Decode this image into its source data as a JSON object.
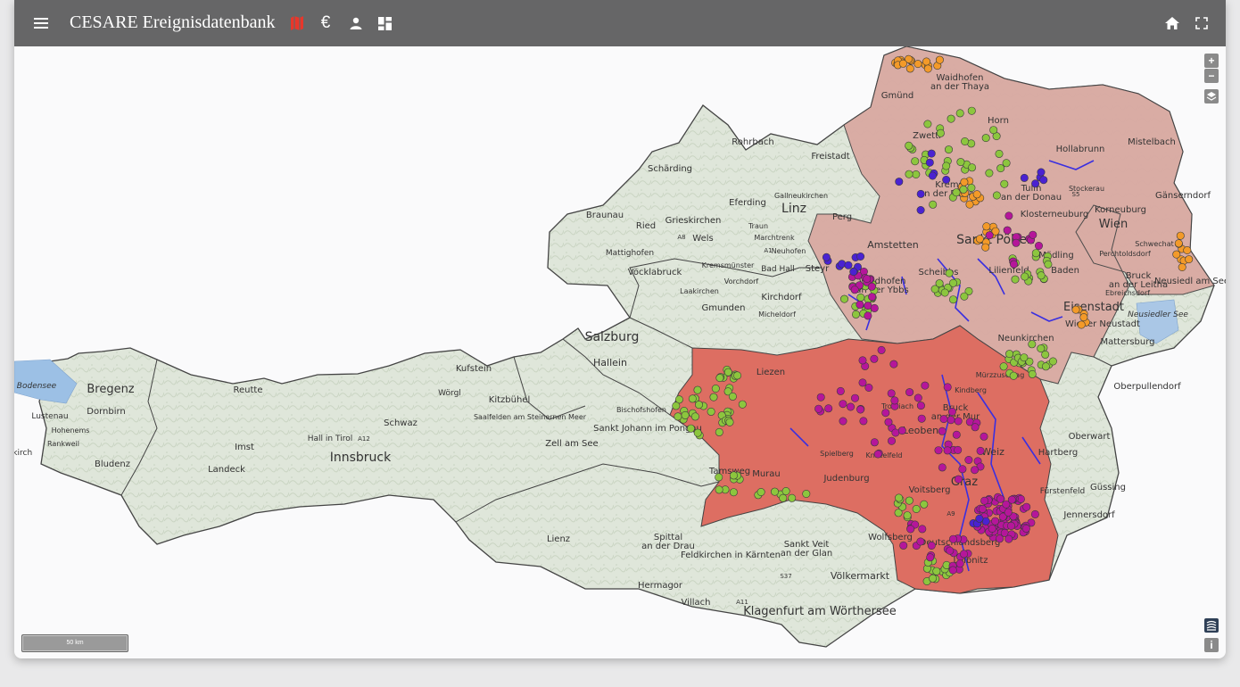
{
  "toolbar": {
    "title": "CESARE Ereignisdatenbank",
    "icons": [
      "menu-icon",
      "map-icon",
      "euro-icon",
      "person-icon",
      "dashboard-icon",
      "home-icon",
      "fullscreen-icon"
    ],
    "accent_color": "#e8372b"
  },
  "map_controls": {
    "zoom_in": "+",
    "zoom_out": "−",
    "info": "i"
  },
  "scale_bar": {
    "label": "50 km"
  },
  "legend_colors": {
    "region_light": "#d9a9a2",
    "region_dark": "#dd6e62",
    "point_green": "#8cc63e",
    "point_magenta": "#b5169a",
    "point_blue": "#4a22d1",
    "point_orange": "#f39a29"
  },
  "place_labels": [
    {
      "id": "gmuend",
      "text": "Gmünd"
    },
    {
      "id": "waidhofen-thaya",
      "text": "Waidhofen an der Thaya"
    },
    {
      "id": "horn",
      "text": "Horn"
    },
    {
      "id": "zwettl",
      "text": "Zwettl"
    },
    {
      "id": "hollabrunn",
      "text": "Hollabrunn"
    },
    {
      "id": "mistelbach",
      "text": "Mistelbach"
    },
    {
      "id": "rohrbach",
      "text": "Rohrbach"
    },
    {
      "id": "freistadt",
      "text": "Freistadt"
    },
    {
      "id": "schaerding",
      "text": "Schärding"
    },
    {
      "id": "eferding",
      "text": "Eferding"
    },
    {
      "id": "gallneukirchen",
      "text": "Gallneukirchen"
    },
    {
      "id": "linz",
      "text": "Linz"
    },
    {
      "id": "perg",
      "text": "Perg"
    },
    {
      "id": "krems",
      "text": "Krems an der Donau"
    },
    {
      "id": "tulln",
      "text": "Tulln an der Donau"
    },
    {
      "id": "stockerau",
      "text": "Stockerau"
    },
    {
      "id": "korneuburg",
      "text": "Korneuburg"
    },
    {
      "id": "klosterneuburg",
      "text": "Klosterneuburg"
    },
    {
      "id": "gaenserndorf",
      "text": "Gänserndorf"
    },
    {
      "id": "wien",
      "text": "Wien"
    },
    {
      "id": "braunau",
      "text": "Braunau"
    },
    {
      "id": "ried",
      "text": "Ried"
    },
    {
      "id": "grieskirchen",
      "text": "Grieskirchen"
    },
    {
      "id": "wels",
      "text": "Wels"
    },
    {
      "id": "traun",
      "text": "Traun"
    },
    {
      "id": "marchtrenk",
      "text": "Marchtrenk"
    },
    {
      "id": "neuhofen",
      "text": "Neuhofen"
    },
    {
      "id": "amstetten",
      "text": "Amstetten"
    },
    {
      "id": "st-poelten",
      "text": "Sankt Pölten"
    },
    {
      "id": "schwechat",
      "text": "Schwechat"
    },
    {
      "id": "perchtoldsdorf",
      "text": "Perchtoldsdorf"
    },
    {
      "id": "moedling",
      "text": "Mödling"
    },
    {
      "id": "baden",
      "text": "Baden"
    },
    {
      "id": "bruck-leitha",
      "text": "Bruck an der Leitha"
    },
    {
      "id": "neusiedl",
      "text": "Neusiedl am See"
    },
    {
      "id": "mattighofen",
      "text": "Mattighofen"
    },
    {
      "id": "voecklabruck",
      "text": "Vöcklabruck"
    },
    {
      "id": "kremsmuenster",
      "text": "Kremsmünster"
    },
    {
      "id": "bad-hall",
      "text": "Bad Hall"
    },
    {
      "id": "steyr",
      "text": "Steyr"
    },
    {
      "id": "waidhofen-ybbs",
      "text": "Waidhofen an der Ybbs"
    },
    {
      "id": "scheibbs",
      "text": "Scheibbs"
    },
    {
      "id": "lilienfeld",
      "text": "Lilienfeld"
    },
    {
      "id": "ebreichsdorf",
      "text": "Ebreichsdorf"
    },
    {
      "id": "laakirchen",
      "text": "Laakirchen"
    },
    {
      "id": "vorchdorf",
      "text": "Vorchdorf"
    },
    {
      "id": "kirchdorf",
      "text": "Kirchdorf"
    },
    {
      "id": "gmunden",
      "text": "Gmunden"
    },
    {
      "id": "micheldorf",
      "text": "Micheldorf"
    },
    {
      "id": "eisenstadt",
      "text": "Eisenstadt"
    },
    {
      "id": "neusiedler-see",
      "text": "Neusiedler See"
    },
    {
      "id": "wiener-neustadt",
      "text": "Wiener Neustadt"
    },
    {
      "id": "neunkirchen",
      "text": "Neunkirchen"
    },
    {
      "id": "mattersburg",
      "text": "Mattersburg"
    },
    {
      "id": "salzburg",
      "text": "Salzburg"
    },
    {
      "id": "hallein",
      "text": "Hallein"
    },
    {
      "id": "liezen",
      "text": "Liezen"
    },
    {
      "id": "muerzzuschlag",
      "text": "Mürzzuschlag"
    },
    {
      "id": "kapfenberg",
      "text": "Kindberg"
    },
    {
      "id": "oberpullendorf",
      "text": "Oberpullendorf"
    },
    {
      "id": "bodensee",
      "text": "Bodensee"
    },
    {
      "id": "bregenz",
      "text": "Bregenz"
    },
    {
      "id": "reutte",
      "text": "Reutte"
    },
    {
      "id": "kufstein",
      "text": "Kufstein"
    },
    {
      "id": "woergl",
      "text": "Wörgl"
    },
    {
      "id": "kitzbuehel",
      "text": "Kitzbühel"
    },
    {
      "id": "bischofshofen",
      "text": "Bischofshofen"
    },
    {
      "id": "trofaiach",
      "text": "Trofaiach"
    },
    {
      "id": "bruck-mur",
      "text": "Bruck an der Mur"
    },
    {
      "id": "lustenau",
      "text": "Lustenau"
    },
    {
      "id": "dornbirn",
      "text": "Dornbirn"
    },
    {
      "id": "hohenems",
      "text": "Hohenems"
    },
    {
      "id": "schwaz",
      "text": "Schwaz"
    },
    {
      "id": "saalfelden",
      "text": "Saalfelden am Steinernen Meer"
    },
    {
      "id": "st-johann",
      "text": "Sankt Johann im Pongau"
    },
    {
      "id": "leoben",
      "text": "Leoben"
    },
    {
      "id": "oberwart",
      "text": "Oberwart"
    },
    {
      "id": "rankweil",
      "text": "Rankweil"
    },
    {
      "id": "hall",
      "text": "Hall in Tirol"
    },
    {
      "id": "a12",
      "text": "A12"
    },
    {
      "id": "imst",
      "text": "Imst"
    },
    {
      "id": "innsbruck",
      "text": "Innsbruck"
    },
    {
      "id": "zell-see",
      "text": "Zell am See"
    },
    {
      "id": "feldkirch",
      "text": "Feldkirch"
    },
    {
      "id": "bludenz",
      "text": "Bludenz"
    },
    {
      "id": "landeck",
      "text": "Landeck"
    },
    {
      "id": "spielberg",
      "text": "Spielberg"
    },
    {
      "id": "knittelfeld",
      "text": "Knittelfeld"
    },
    {
      "id": "weiz",
      "text": "Weiz"
    },
    {
      "id": "hartberg",
      "text": "Hartberg"
    },
    {
      "id": "tamsweg",
      "text": "Tamsweg"
    },
    {
      "id": "murau",
      "text": "Murau"
    },
    {
      "id": "judenburg",
      "text": "Judenburg"
    },
    {
      "id": "voitsberg",
      "text": "Voitsberg"
    },
    {
      "id": "graz",
      "text": "Graz"
    },
    {
      "id": "fuerstenfeld",
      "text": "Fürstenfeld"
    },
    {
      "id": "guessing",
      "text": "Güssing"
    },
    {
      "id": "jennersdorf",
      "text": "Jennersdorf"
    },
    {
      "id": "lienz",
      "text": "Lienz"
    },
    {
      "id": "spittal",
      "text": "Spittal an der Drau"
    },
    {
      "id": "st-veit",
      "text": "Sankt Veit an der Glan"
    },
    {
      "id": "wolfsberg",
      "text": "Wolfsberg"
    },
    {
      "id": "feldkirchen",
      "text": "Feldkirchen in Kärnten"
    },
    {
      "id": "deutschlandsberg",
      "text": "Deutschlandsberg"
    },
    {
      "id": "voelkermarkt",
      "text": "Völkermarkt"
    },
    {
      "id": "hermagor",
      "text": "Hermagor"
    },
    {
      "id": "s37",
      "text": "S37"
    },
    {
      "id": "leibnitz",
      "text": "Leibnitz"
    },
    {
      "id": "villach",
      "text": "Villach"
    },
    {
      "id": "a11",
      "text": "A11"
    },
    {
      "id": "klagenfurt",
      "text": "Klagenfurt am Wörthersee"
    },
    {
      "id": "a8",
      "text": "A8"
    },
    {
      "id": "a1",
      "text": "A1"
    },
    {
      "id": "s5",
      "text": "S5"
    },
    {
      "id": "a9",
      "text": "A9"
    }
  ]
}
